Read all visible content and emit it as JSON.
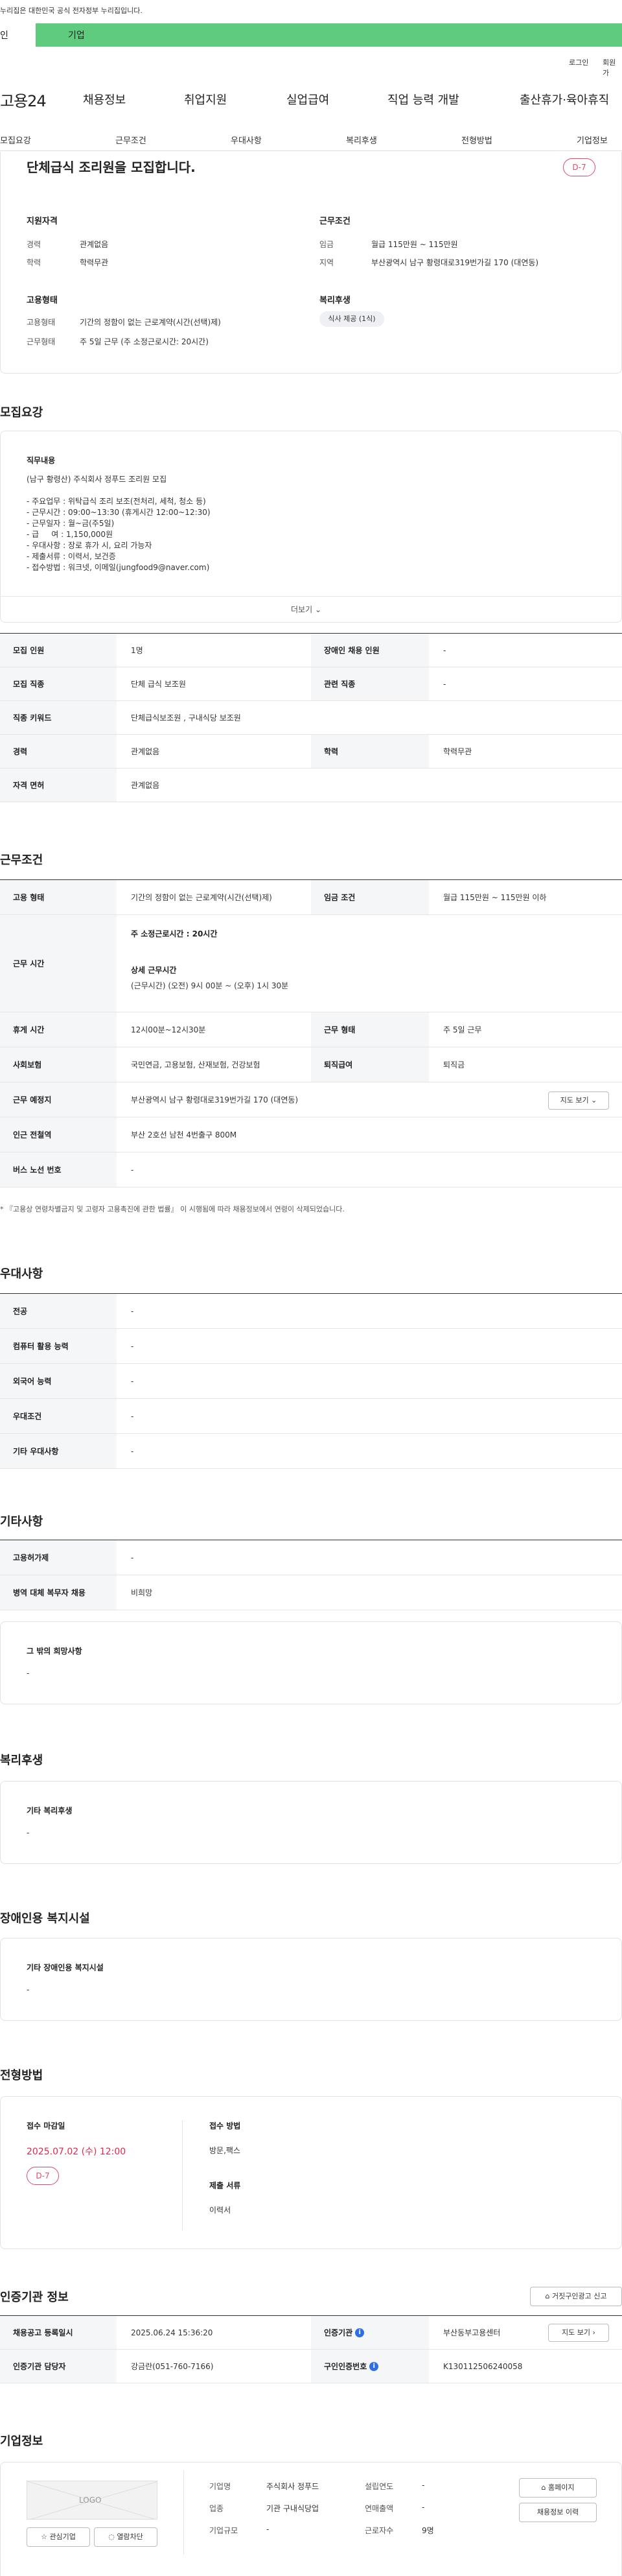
{
  "gov_banner": "누리집은 대한민국 공식 전자정부 누리집입니다.",
  "tabs": {
    "individual": "인",
    "company": "기업"
  },
  "top_links": {
    "login": "로그인",
    "join": "회원가"
  },
  "logo": "고용24",
  "gnb": [
    "채용정보",
    "취업지원",
    "실업급여",
    "직업 능력 개발",
    "출산휴가·육아휴직"
  ],
  "lnb": [
    "모집요강",
    "근무조건",
    "우대사항",
    "복리후생",
    "전형방법",
    "기업정보"
  ],
  "summary": {
    "title": "단체급식 조리원을 모집합니다.",
    "dday": "D-7",
    "qual": {
      "heading": "지원자격",
      "rows": [
        {
          "label": "경력",
          "value": "관계없음"
        },
        {
          "label": "학력",
          "value": "학력무관"
        }
      ]
    },
    "cond": {
      "heading": "근무조건",
      "rows": [
        {
          "label": "임금",
          "value": "월급 115만원 ~ 115만원"
        },
        {
          "label": "지역",
          "value": "부산광역시 남구 황령대로319번가길 170 (대연동)"
        }
      ]
    },
    "emp": {
      "heading": "고용형태",
      "rows": [
        {
          "label": "고용형태",
          "value": "기간의 정함이 없는 근로계약(시간(선택)제)"
        },
        {
          "label": "근무형태",
          "value": "주 5일 근무 (주 소정근로시간: 20시간)"
        }
      ]
    },
    "welfare": {
      "heading": "복리후생",
      "chip": "식사 제공 (1식)"
    }
  },
  "recruit": {
    "heading": "모집요강",
    "duty_heading": "직무내용",
    "duty_text": "(남구 황령산) 주식회사 정푸드 조리원 모집\n\n- 주요업무 : 위탁급식 조리 보조(전처리, 세척, 청소 등)\n- 근무시간 : 09:00~13:30 (휴게시간 12:00~12:30)\n- 근무일자 : 월~금(주5일)\n- 급     여 : 1,150,000원\n- 우대사항 : 장로 휴가 시, 요리 가능자\n- 제출서류 : 이력서, 보건증\n- 접수방법 : 워크넷, 이메일(jungfood9@naver.com)",
    "more": "더보기",
    "rows": [
      {
        "k1": "모집 인원",
        "v1": "1명",
        "k2": "장애인 채용 인원",
        "v2": "-"
      },
      {
        "k1": "모집 직종",
        "v1": "단체 급식 보조원",
        "k2": "관련 직종",
        "v2": "-"
      },
      {
        "k1": "직종 키워드",
        "v1": "단체급식보조원 , 구내식당 보조원"
      },
      {
        "k1": "경력",
        "v1": "관계없음",
        "k2": "학력",
        "v2": "학력무관"
      },
      {
        "k1": "자격 면허",
        "v1": "관계없음"
      }
    ]
  },
  "work": {
    "heading": "근무조건",
    "employ_type_label": "고용 형태",
    "employ_type": "기간의 정함이 없는 근로계약(시간(선택)제)",
    "wage_label": "임금 조건",
    "wage": "월급 115만원 ~ 115만원 이하",
    "hours_label": "근무 시간",
    "weekly_hours": "주 소정근로시간 : 20시간",
    "detail_heading": "상세 근무시간",
    "detail": "(근무시간) (오전) 9시 00분 ~ (오후) 1시 30분",
    "rest_label": "휴게 시간",
    "rest": "12시00분~12시30분",
    "form_label": "근무 형태",
    "form": "주 5일 근무",
    "ins_label": "사회보험",
    "ins": "국민연금, 고용보험, 산재보험, 건강보험",
    "ret_label": "퇴직급여",
    "ret": "퇴직금",
    "loc_label": "근무 예정지",
    "loc": "부산광역시 남구 황령대로319번가길 170 (대연동)",
    "map_btn": "지도 보기",
    "sub_label": "인근 전철역",
    "sub": "부산 2호선 남천 4번출구 800M",
    "bus_label": "버스 노선 번호",
    "bus": "-",
    "note": "* 『고용상 연령차별금지 및 고령자 고용촉진에 관한 법률』 이 시행됨에 따라 채용정보에서 연령이 삭제되었습니다."
  },
  "pref": {
    "heading": "우대사항",
    "rows": [
      {
        "k": "전공",
        "v": "-"
      },
      {
        "k": "컴퓨터 활용 능력",
        "v": "-"
      },
      {
        "k": "외국어 능력",
        "v": "-"
      },
      {
        "k": "우대조건",
        "v": "-"
      },
      {
        "k": "기타 우대사항",
        "v": "-"
      }
    ]
  },
  "etc": {
    "heading": "기타사항",
    "rows": [
      {
        "k": "고용허가제",
        "v": "-"
      },
      {
        "k": "병역 대체 복무자 채용",
        "v": "비희망"
      }
    ],
    "wish_heading": "그 밖의 희망사항",
    "wish": "-"
  },
  "benefit": {
    "heading": "복리후생",
    "sub": "기타 복리후생",
    "value": "-"
  },
  "disabled": {
    "heading": "장애인용 복지시설",
    "sub": "기타 장애인용 복지시설",
    "value": "-"
  },
  "screen": {
    "heading": "전형방법",
    "deadline_label": "접수 마감일",
    "deadline": "2025.07.02 (수) 12:00",
    "dday": "D-7",
    "method_label": "접수 방법",
    "method": "방문,팩스",
    "docs_label": "제출 서류",
    "docs": "이력서"
  },
  "cert": {
    "heading": "인증기관 정보",
    "report_btn": "거짓구인광고 신고",
    "reg_label": "채용공고 등록일시",
    "reg": "2025.06.24 15:36:20",
    "org_label": "인증기관",
    "org": "부산동부고용센터",
    "map_btn": "지도 보기",
    "mgr_label": "인증기관 담당자",
    "mgr": "강금란(051-760-7166)",
    "num_label": "구인인증번호",
    "num": "K130112506240058"
  },
  "company": {
    "heading": "기업정보",
    "logo": "LOGO",
    "fav_btn": "관심기업",
    "block_btn": "열람차단",
    "name_label": "기업명",
    "name": "주식회사 정푸드",
    "est_label": "설립연도",
    "est": "-",
    "ind_label": "업종",
    "ind": "기관 구내식당업",
    "sales_label": "연매출액",
    "sales": "-",
    "size_label": "기업규모",
    "size": "-",
    "emp_label": "근로자수",
    "emp": "9명",
    "home_btn": "홈페이지",
    "hist_btn": "채용정보 이력"
  }
}
